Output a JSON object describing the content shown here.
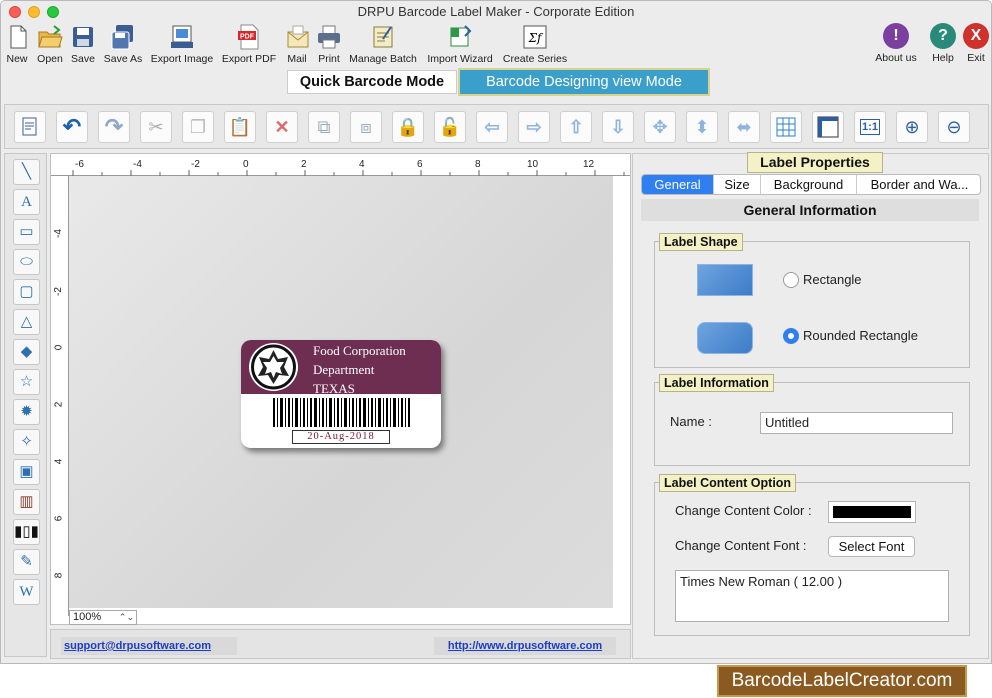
{
  "window": {
    "title": "DRPU Barcode Label Maker - Corporate Edition"
  },
  "main_toolbar": {
    "left": [
      {
        "label": "New",
        "icon": "new-file-icon"
      },
      {
        "label": "Open",
        "icon": "open-folder-icon"
      },
      {
        "label": "Save",
        "icon": "save-icon"
      },
      {
        "label": "Save As",
        "icon": "save-as-icon"
      },
      {
        "label": "Export Image",
        "icon": "export-image-icon"
      },
      {
        "label": "Export PDF",
        "icon": "export-pdf-icon"
      },
      {
        "label": "Mail",
        "icon": "mail-icon"
      },
      {
        "label": "Print",
        "icon": "print-icon"
      },
      {
        "label": "Manage Batch",
        "icon": "manage-batch-icon"
      },
      {
        "label": "Import Wizard",
        "icon": "import-wizard-icon"
      },
      {
        "label": "Create Series",
        "icon": "create-series-icon"
      }
    ],
    "right": [
      {
        "label": "About us",
        "glyph": "!",
        "color": "#7b3fa0"
      },
      {
        "label": "Help",
        "glyph": "?",
        "color": "#2a8a7a"
      },
      {
        "label": "Exit",
        "glyph": "X",
        "color": "#d0312d"
      }
    ],
    "pdf_badge": "PDF",
    "series_glyph": "Σf"
  },
  "modes": {
    "quick": "Quick Barcode Mode",
    "design": "Barcode Designing view Mode"
  },
  "ruler": {
    "h_ticks": [
      "-6",
      "-4",
      "-2",
      "0",
      "2",
      "4",
      "6",
      "8",
      "10",
      "12"
    ],
    "v_ticks": [
      "-4",
      "-2",
      "0",
      "2",
      "4",
      "6",
      "8"
    ]
  },
  "canvas": {
    "zoom": "100%"
  },
  "label": {
    "line1": "Food Corporation",
    "line2": "Department",
    "line3": "TEXAS",
    "date": "20-Aug-2018",
    "header_color": "#6d2e52"
  },
  "footer": {
    "support": "support@drpusoftware.com",
    "website": "http://www.drpusoftware.com"
  },
  "properties": {
    "title": "Label Properties",
    "tabs": [
      "General",
      "Size",
      "Background",
      "Border and Wa..."
    ],
    "active_tab": "General",
    "section_title": "General Information",
    "label_shape": {
      "title": "Label Shape",
      "options": [
        "Rectangle",
        "Rounded Rectangle"
      ],
      "selected": "Rounded Rectangle"
    },
    "label_info": {
      "title": "Label Information",
      "name_label": "Name :",
      "name_value": "Untitled"
    },
    "content_option": {
      "title": "Label Content Option",
      "color_label": "Change Content Color :",
      "color_value": "#000000",
      "font_label": "Change Content Font :",
      "font_button": "Select Font",
      "font_value": "Times New Roman ( 12.00 )"
    }
  },
  "brand": "BarcodeLabelCreator.com"
}
